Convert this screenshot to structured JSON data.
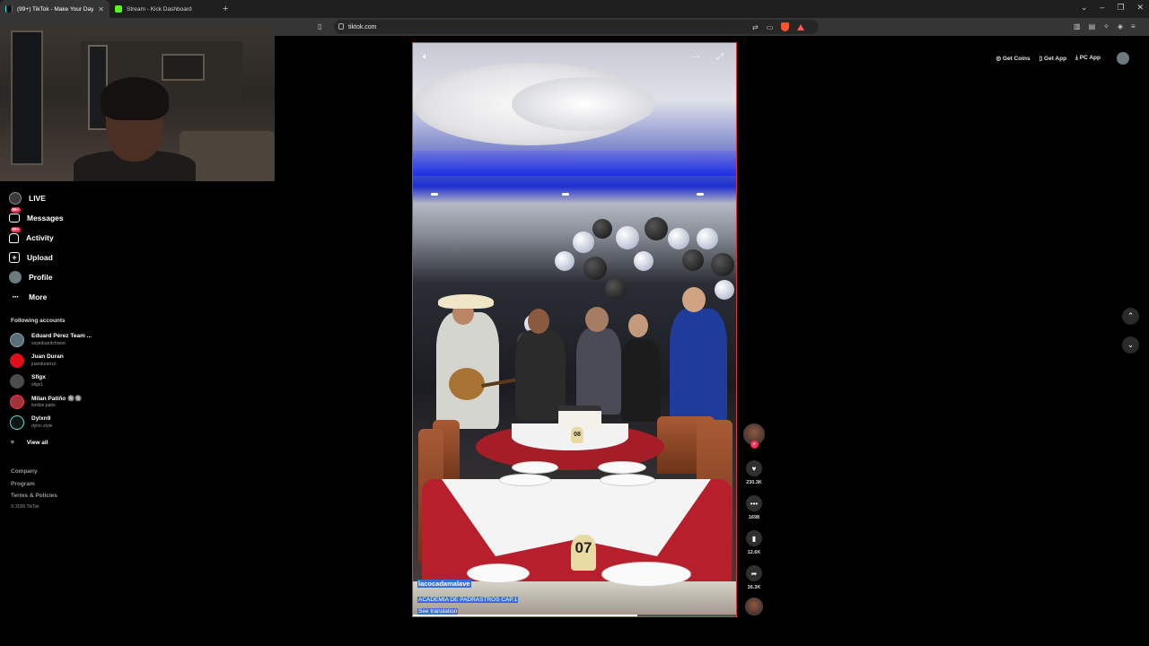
{
  "browser": {
    "tabs": [
      {
        "title": "(99+) TikTok - Make Your Day",
        "active": true
      },
      {
        "title": "Stream - Kick Dashboard",
        "active": false
      }
    ],
    "url": "tiktok.com"
  },
  "sidebar": {
    "nav": [
      {
        "label": "LIVE",
        "icon": "live-icon"
      },
      {
        "label": "Messages",
        "icon": "messages-icon",
        "badge": "99+"
      },
      {
        "label": "Activity",
        "icon": "activity-icon",
        "badge": "99+"
      },
      {
        "label": "Upload",
        "icon": "upload-icon"
      },
      {
        "label": "Profile",
        "icon": "profile-icon"
      },
      {
        "label": "More",
        "icon": "more-icon"
      }
    ],
    "following_title": "Following accounts",
    "following": [
      {
        "name": "Eduard Pérez Team ...",
        "handle": "soyeduardchistet",
        "color": "#5a6d7a"
      },
      {
        "name": "Juan Duran",
        "handle": "juanduranzz",
        "color": "#e0101a"
      },
      {
        "name": "Sfigx",
        "handle": "sfigx1",
        "color": "#4c4c4c"
      },
      {
        "name": "Milan Patiño 🔘🔘",
        "handle": "kmilan.patio",
        "color": "#a0343b"
      },
      {
        "name": "Dylxn9",
        "handle": "dylxn.style",
        "color": "#0f1414"
      }
    ],
    "view_all": "View all",
    "footer": [
      "Company",
      "Program",
      "Terms & Policies"
    ],
    "copyright": "© 2026 TikTok"
  },
  "header_actions": {
    "get_coins": "Get Coins",
    "get_app": "Get App",
    "pc_app": "PC App"
  },
  "video": {
    "username": "lacocadamalave",
    "description": "ACADEMIA DE PADRASTROS CAP.1",
    "translation": "See translation",
    "table_numbers": [
      "08",
      "07"
    ],
    "progress": 0.69
  },
  "actions": {
    "likes": "230.3K",
    "comments": "1698",
    "saves": "12.6K",
    "shares": "36.3K"
  },
  "colors": {
    "accent": "#fe2c55",
    "video_border": "#e0343c",
    "selection": "#3a6ecf"
  }
}
